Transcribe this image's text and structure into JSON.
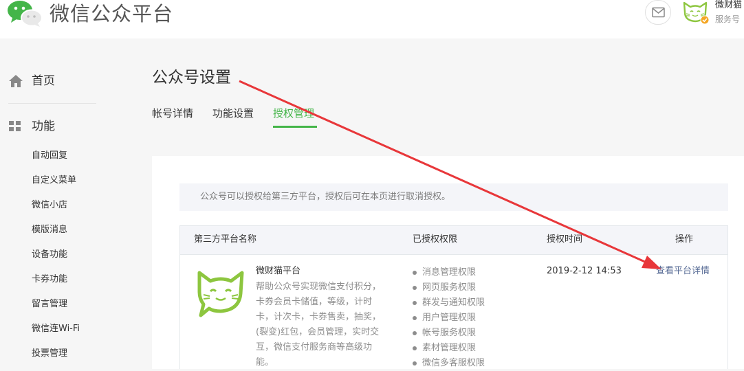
{
  "header": {
    "brand": "微信公众平台",
    "account_name": "微财猫",
    "account_type": "服务号",
    "icons": {
      "logo": "wechat-logo-icon",
      "mail": "mail-icon",
      "avatar": "cat-avatar-icon",
      "verified": "verified-badge-icon"
    }
  },
  "sidebar": {
    "home_label": "首页",
    "function_label": "功能",
    "items": [
      "自动回复",
      "自定义菜单",
      "微信小店",
      "模版消息",
      "设备功能",
      "卡券功能",
      "留言管理",
      "微信连Wi-Fi",
      "投票管理"
    ]
  },
  "main": {
    "title": "公众号设置",
    "tabs": [
      {
        "label": "帐号详情",
        "active": false
      },
      {
        "label": "功能设置",
        "active": false
      },
      {
        "label": "授权管理",
        "active": true
      }
    ],
    "notice": "公众号可以授权给第三方平台，授权后可在本页进行取消授权。",
    "table": {
      "headers": [
        "第三方平台名称",
        "已授权权限",
        "授权时间",
        "操作"
      ],
      "rows": [
        {
          "name": "微财猫平台",
          "description": "帮助公众号实现微信支付积分，卡券会员卡储值，等级，计时卡，计次卡，卡券售卖，抽奖，(裂变)红包，会员管理，实时交互，微信支付服务商等高级功能。",
          "permissions": [
            "消息管理权限",
            "网页服务权限",
            "群发与通知权限",
            "用户管理权限",
            "帐号服务权限",
            "素材管理权限",
            "微信多客服权限"
          ],
          "time": "2019-2-12 14:53",
          "action": "查看平台详情"
        }
      ]
    }
  },
  "colors": {
    "accent": "#44b549",
    "link": "#576b95",
    "annotation_arrow": "#e8373a"
  }
}
